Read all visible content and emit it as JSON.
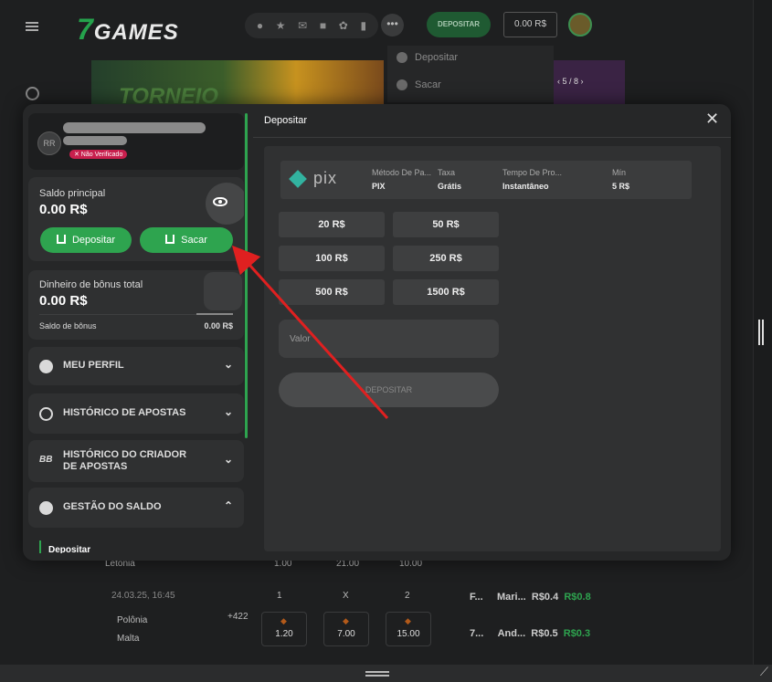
{
  "header": {
    "logo": "GAMES",
    "logo_number": "7",
    "deposit_label": "DEPOSITAR",
    "balance": "0.00 R$",
    "more": "•••",
    "dropdown": [
      "Depositar",
      "Sacar"
    ]
  },
  "banner": {
    "text": "TORNEIO",
    "pager": "5 / 8"
  },
  "background": {
    "row1_team": "Letonia",
    "row1_odds": [
      "1.00",
      "21.00",
      "10.00"
    ],
    "date": "24.03.25, 16:45",
    "cols": [
      "1",
      "X",
      "2"
    ],
    "team_a": "Polônia",
    "team_b": "Malta",
    "markets": "+422",
    "odds": [
      "1.20",
      "7.00",
      "15.00"
    ],
    "right_games": [
      {
        "game": "F...",
        "user": "Mari...",
        "bet": "R$0.4",
        "win": "R$0.8"
      },
      {
        "game": "7...",
        "user": "And...",
        "bet": "R$0.5",
        "win": "R$0.3"
      }
    ]
  },
  "modal": {
    "user_initials": "RR",
    "unverified": "✕ Não Verificado",
    "main_balance_label": "Saldo principal",
    "main_balance": "0.00 R$",
    "deposit_btn": "Depositar",
    "withdraw_btn": "Sacar",
    "bonus_label": "Dinheiro de bônus total",
    "bonus_amount": "0.00 R$",
    "bonus_balance_label": "Saldo de bônus",
    "bonus_balance": "0.00 R$",
    "menu": [
      {
        "label": "MEU PERFIL",
        "chevron": "⌄"
      },
      {
        "label": "HISTÓRICO DE APOSTAS",
        "chevron": "⌄"
      },
      {
        "label": "HISTÓRICO DO CRIADOR DE APOSTAS",
        "chevron": "⌄"
      },
      {
        "label": "GESTÃO DO SALDO",
        "chevron": "⌃"
      }
    ],
    "sub_item": "Depositar",
    "title": "Depositar",
    "close": "✕",
    "method": {
      "logo": "pix",
      "columns": [
        {
          "header": "Método De Pa...",
          "value": "PIX"
        },
        {
          "header": "Taxa",
          "value": "Grátis"
        },
        {
          "header": "Tempo De Pro...",
          "value": "Instantâneo"
        },
        {
          "header": "Mín",
          "value": "5 R$"
        }
      ]
    },
    "amounts": [
      "20 R$",
      "50 R$",
      "100 R$",
      "250 R$",
      "500 R$",
      "1500 R$"
    ],
    "valor_placeholder": "Valor",
    "submit": "DEPOSITAR"
  },
  "colors": {
    "accent": "#2ea44f",
    "arrow": "#e02020",
    "badge": "#c81f4d"
  }
}
